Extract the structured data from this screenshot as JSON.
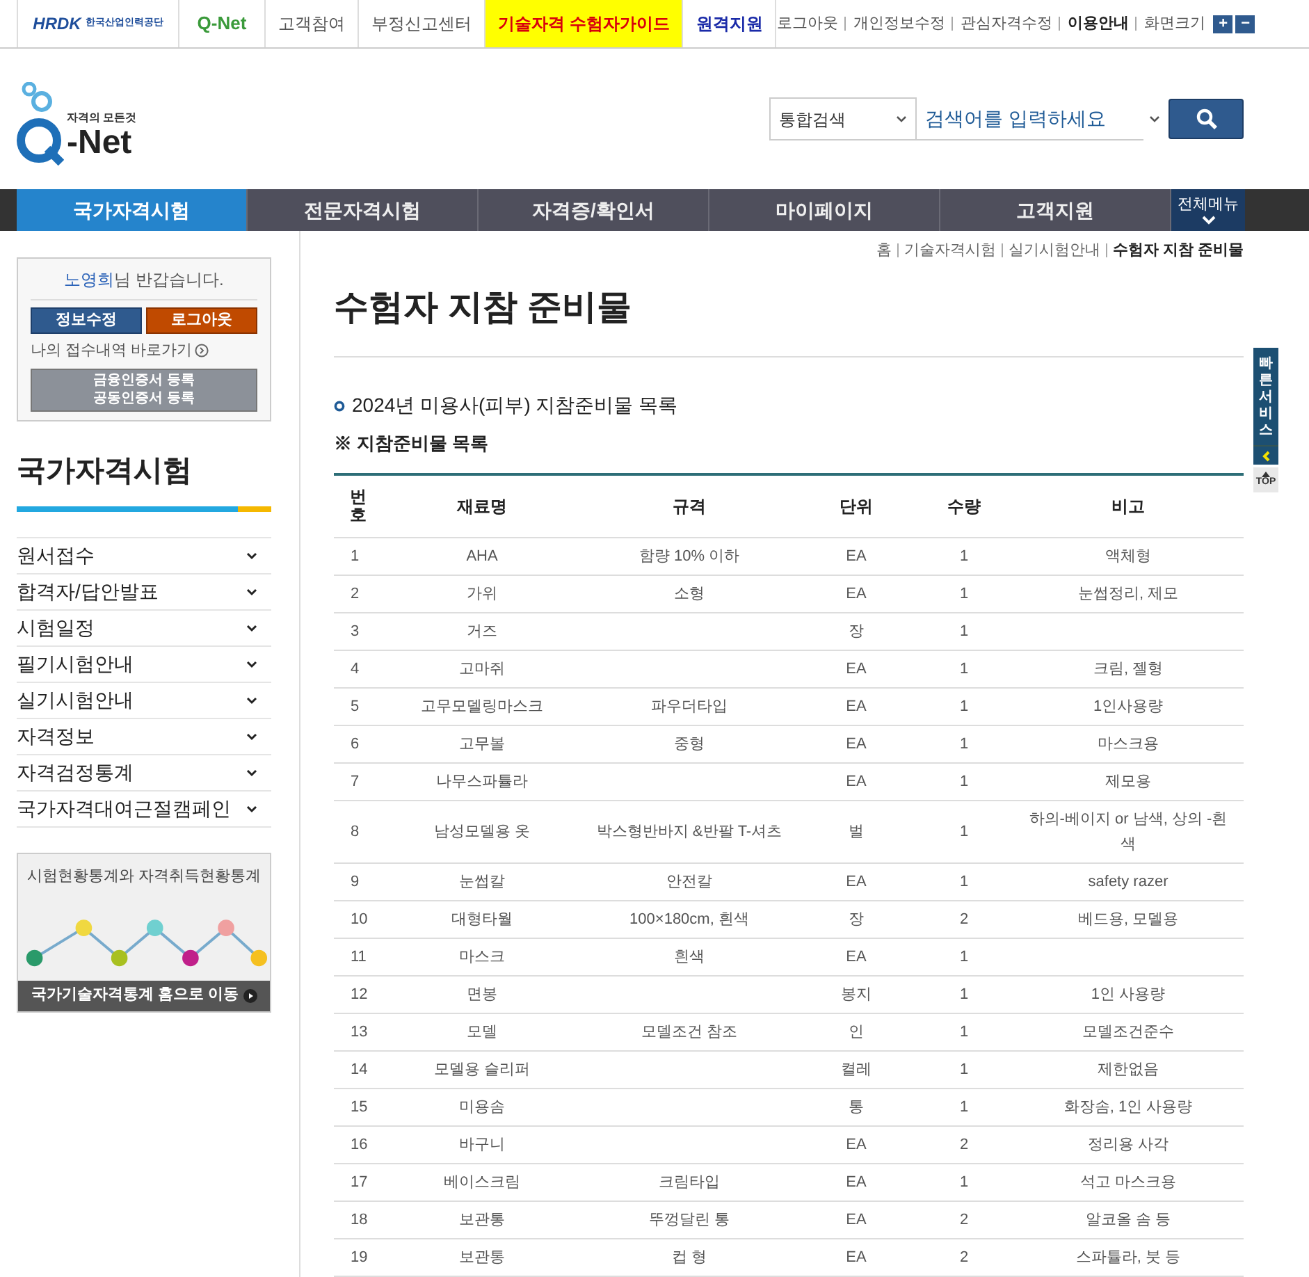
{
  "top_bar": {
    "org_logo": {
      "mark": "HRDK",
      "name": "한국산업인력공단"
    },
    "site_logo": "Q-Net",
    "links": [
      {
        "label": "고객참여",
        "kind": "plain"
      },
      {
        "label": "부정신고센터",
        "kind": "plain"
      },
      {
        "label": "기술자격 수험자가이드",
        "kind": "highlight"
      },
      {
        "label": "원격지원",
        "kind": "accent"
      }
    ],
    "utility_links": [
      {
        "label": "로그아웃",
        "emphasis": false
      },
      {
        "label": "개인정보수정",
        "emphasis": false
      },
      {
        "label": "관심자격수정",
        "emphasis": false
      },
      {
        "label": "이용안내",
        "emphasis": true
      },
      {
        "label": "화면크기",
        "emphasis": false
      }
    ],
    "zoom_buttons": [
      "+",
      "−"
    ]
  },
  "header": {
    "logo": {
      "tagline": "자격의 모든것",
      "name": "-Net"
    },
    "search": {
      "scope": "통합검색",
      "placeholder": "검색어를 입력하세요"
    }
  },
  "nav": {
    "items": [
      {
        "label": "국가자격시험",
        "selected": true
      },
      {
        "label": "전문자격시험",
        "selected": false
      },
      {
        "label": "자격증/확인서",
        "selected": false
      },
      {
        "label": "마이페이지",
        "selected": false
      },
      {
        "label": "고객지원",
        "selected": false
      }
    ],
    "all_menu": "전체메뉴"
  },
  "login_box": {
    "user": "노영희",
    "greeting": "님 반갑습니다.",
    "buttons": [
      "정보수정",
      "로그아웃"
    ],
    "history_link": "나의 접수내역 바로가기",
    "cert_button": [
      "금융인증서 등록",
      "공동인증서 등록"
    ]
  },
  "sidebar": {
    "title": "국가자격시험",
    "items": [
      {
        "label": "원서접수",
        "expanded": false
      },
      {
        "label": "합격자/답안발표",
        "expanded": false
      },
      {
        "label": "시험일정",
        "expanded": false
      },
      {
        "label": "필기시험안내",
        "expanded": false
      },
      {
        "label": "실기시험안내",
        "expanded": false
      },
      {
        "label": "자격정보",
        "expanded": false
      },
      {
        "label": "자격검정통계",
        "expanded": false
      },
      {
        "label": "국가자격대여근절캠페인",
        "expanded": false
      }
    ],
    "banner": {
      "title": "시험현황통계와 자격취득현황통계",
      "link": "국가기술자격통계 홈으로 이동"
    }
  },
  "breadcrumb": [
    "홈",
    "기술자격시험",
    "실기시험안내",
    "수험자 지참 준비물"
  ],
  "page_title": "수험자 지참 준비물",
  "section_title": "2024년 미용사(피부) 지참준비물 목록",
  "note": "※ 지참준비물 목록",
  "table": {
    "columns": [
      "번호",
      "재료명",
      "규격",
      "단위",
      "수량",
      "비고"
    ],
    "rows": [
      [
        "1",
        "AHA",
        "함량 10% 이하",
        "EA",
        "1",
        "액체형"
      ],
      [
        "2",
        "가위",
        "소형",
        "EA",
        "1",
        "눈썹정리, 제모"
      ],
      [
        "3",
        "거즈",
        "",
        "장",
        "1",
        ""
      ],
      [
        "4",
        "고마쥐",
        "",
        "EA",
        "1",
        "크림, 젤형"
      ],
      [
        "5",
        "고무모델링마스크",
        "파우더타입",
        "EA",
        "1",
        "1인사용량"
      ],
      [
        "6",
        "고무볼",
        "중형",
        "EA",
        "1",
        "마스크용"
      ],
      [
        "7",
        "나무스파튤라",
        "",
        "EA",
        "1",
        "제모용"
      ],
      [
        "8",
        "남성모델용 옷",
        "박스형반바지 &반팔 T-셔츠",
        "벌",
        "1",
        "하의-베이지 or 남색, 상의 -흰색"
      ],
      [
        "9",
        "눈썹칼",
        "안전칼",
        "EA",
        "1",
        "safety razer"
      ],
      [
        "10",
        "대형타월",
        "100×180cm, 흰색",
        "장",
        "2",
        "베드용, 모델용"
      ],
      [
        "11",
        "마스크",
        "흰색",
        "EA",
        "1",
        ""
      ],
      [
        "12",
        "면봉",
        "",
        "봉지",
        "1",
        "1인 사용량"
      ],
      [
        "13",
        "모델",
        "모델조건 참조",
        "인",
        "1",
        "모델조건준수"
      ],
      [
        "14",
        "모델용 슬리퍼",
        "",
        "켤레",
        "1",
        "제한없음"
      ],
      [
        "15",
        "미용솜",
        "",
        "통",
        "1",
        "화장솜, 1인 사용량"
      ],
      [
        "16",
        "바구니",
        "",
        "EA",
        "2",
        "정리용 사각"
      ],
      [
        "17",
        "베이스크림",
        "크림타입",
        "EA",
        "1",
        "석고 마스크용"
      ],
      [
        "18",
        "보관통",
        "뚜껑달린 통",
        "EA",
        "2",
        "알코올 솜 등"
      ],
      [
        "19",
        "보관통",
        "컵 형",
        "EA",
        "2",
        "스파튤라, 붓 등"
      ]
    ]
  },
  "quick_service": {
    "label": "빠른서비스",
    "top": "TOP"
  }
}
